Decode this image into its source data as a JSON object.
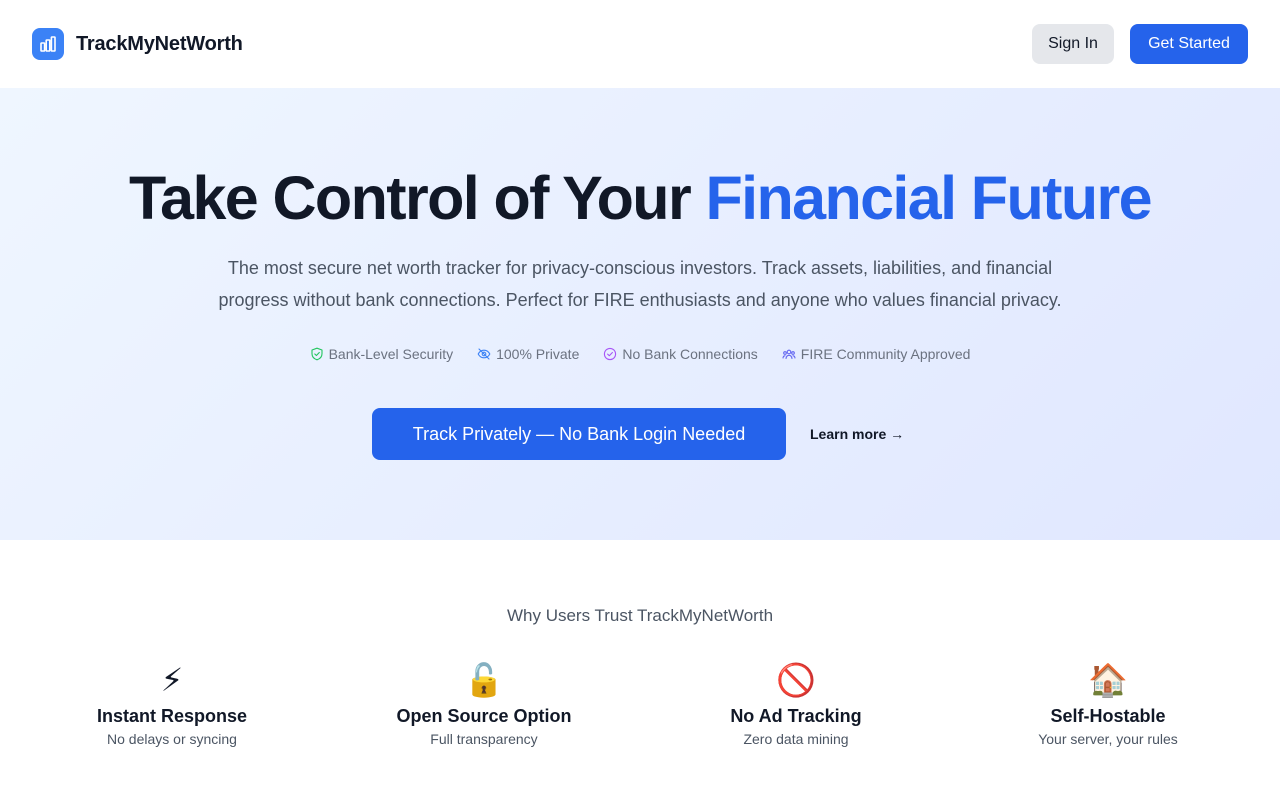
{
  "header": {
    "brand_name": "TrackMyNetWorth",
    "logo_icon": "bar-chart-icon",
    "sign_in_label": "Sign In",
    "get_started_label": "Get Started"
  },
  "hero": {
    "title_part1": "Take Control of Your ",
    "title_accent": "Financial Future",
    "subtitle_line1": "The most secure net worth tracker for privacy-conscious investors. Track assets, liabilities, and financial",
    "subtitle_line2": "progress without bank connections. Perfect for FIRE enthusiasts and anyone who values financial privacy.",
    "badges": [
      {
        "icon": "shield-check-icon",
        "label": "Bank-Level Security",
        "color": "#22c55e"
      },
      {
        "icon": "eye-off-icon",
        "label": "100% Private",
        "color": "#3b82f6"
      },
      {
        "icon": "check-circle-icon",
        "label": "No Bank Connections",
        "color": "#a855f7"
      },
      {
        "icon": "community-icon",
        "label": "FIRE Community Approved",
        "color": "#6366f1"
      }
    ],
    "cta_label": "Track Privately — No Bank Login Needed",
    "learn_more_label": "Learn more →"
  },
  "trust": {
    "heading": "Why Users Trust TrackMyNetWorth",
    "features": [
      {
        "emoji": "⚡",
        "icon": "lightning-icon",
        "title": "Instant Response",
        "desc": "No delays or syncing"
      },
      {
        "emoji": "🔓",
        "icon": "unlock-icon",
        "title": "Open Source Option",
        "desc": "Full transparency"
      },
      {
        "emoji": "🚫",
        "icon": "prohibited-icon",
        "title": "No Ad Tracking",
        "desc": "Zero data mining"
      },
      {
        "emoji": "🏠",
        "icon": "house-icon",
        "title": "Self-Hostable",
        "desc": "Your server, your rules"
      }
    ]
  },
  "colors": {
    "primary": "#2563eb",
    "logo_bg": "#3b82f6",
    "text_dark": "#111827",
    "text_muted": "#4b5563"
  }
}
